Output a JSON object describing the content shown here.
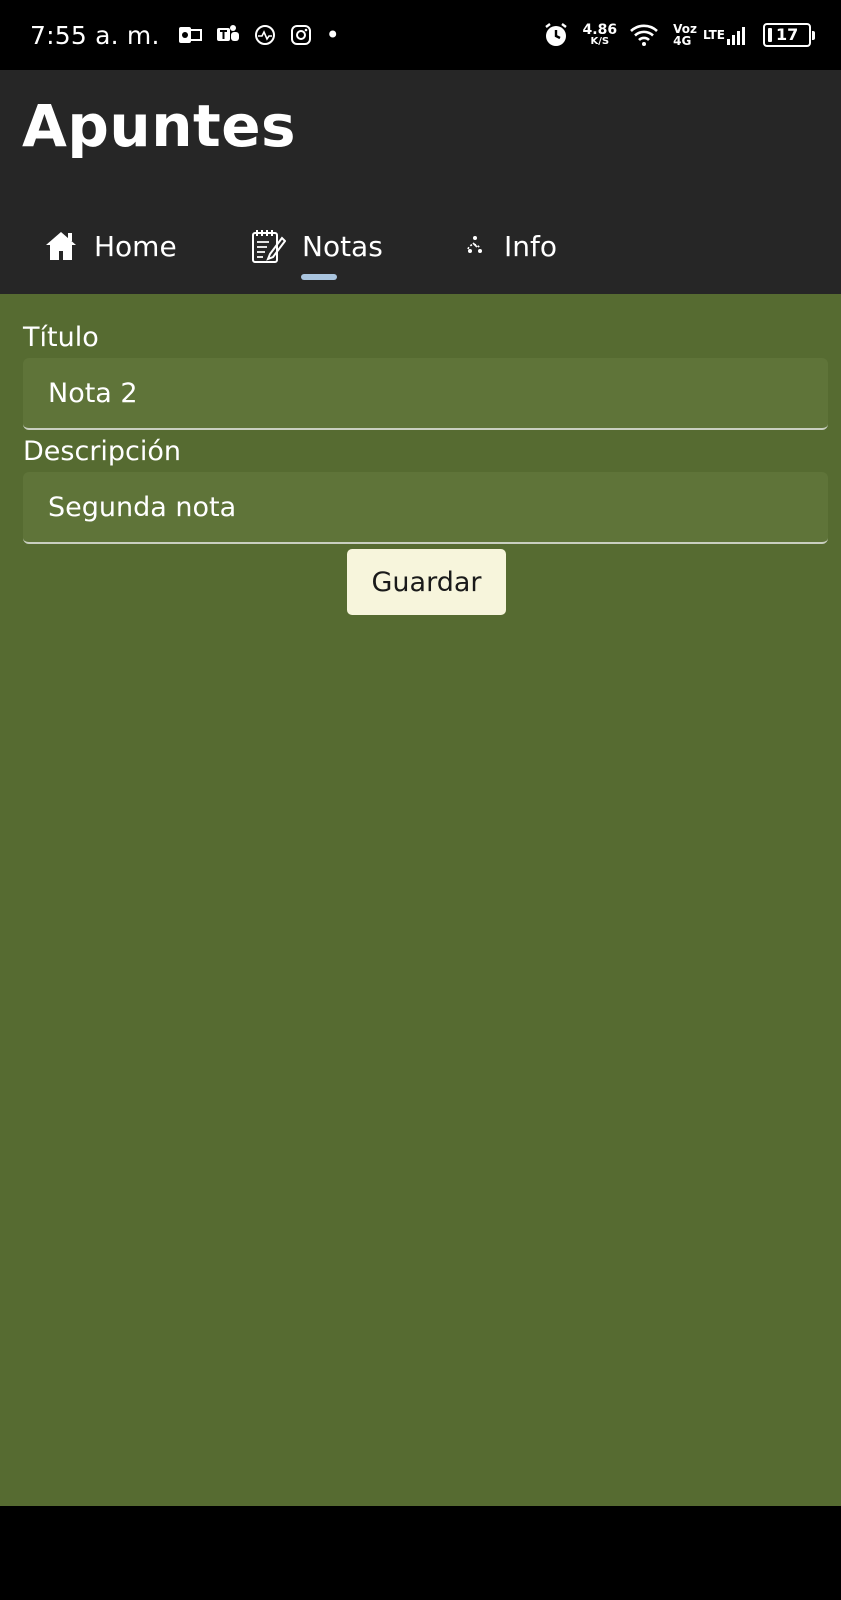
{
  "status_bar": {
    "time": "7:55 a. m.",
    "net_speed": "4.86",
    "net_speed_unit": "K/S",
    "voz": "Voz",
    "net_4g": "4G",
    "lte": "LTE",
    "battery": "17",
    "notification_icons": [
      "outlook-icon",
      "teams-icon",
      "activity-icon",
      "instagram-icon"
    ],
    "dot": "•"
  },
  "app": {
    "title": "Apuntes",
    "colors": {
      "header_bg": "#262626",
      "content_bg": "#566b31",
      "input_bg": "#5f7439",
      "button_bg": "#f7f5dc",
      "tab_indicator": "#a9c4de"
    }
  },
  "tabs": [
    {
      "label": "Home",
      "icon": "home-icon"
    },
    {
      "label": "Notas",
      "icon": "notepad-icon",
      "selected": true
    },
    {
      "label": "Info",
      "icon": "info-icon"
    }
  ],
  "form": {
    "title_label": "Título",
    "title_value": "Nota 2",
    "description_label": "Descripción",
    "description_value": "Segunda nota",
    "save_label": "Guardar"
  }
}
